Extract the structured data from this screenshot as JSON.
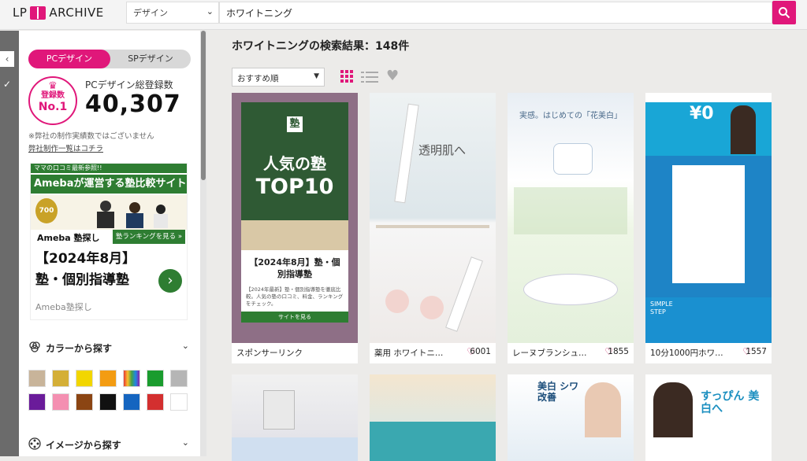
{
  "header": {
    "logo_left": "LP",
    "logo_right": "ARCHIVE",
    "category": "デザイン",
    "search_value": "ホワイトニング"
  },
  "sidebar": {
    "toggle_pc": "PCデザイン",
    "toggle_sp": "SPデザイン",
    "badge_line1": "登録数",
    "badge_line2": "No.1",
    "total_label": "PCデザイン総登録数",
    "total_value": "40,307",
    "note": "※弊社の制作実績数ではございません",
    "note_link": "弊社制作一覧はコチラ",
    "ad": {
      "banner": "ママの口コミ最新参照!!",
      "headline": "Amebaが運営する塾比較サイト",
      "badge": "700",
      "brand": "Ameba 塾探し",
      "cta": "塾ランキングを見る »",
      "title": "【2024年8月】塾・個別指導塾",
      "source": "Ameba塾探し"
    },
    "color_section": "カラーから探す",
    "image_section": "イメージから探す",
    "colors": [
      "#c8b49a",
      "#d4af37",
      "#f2d600",
      "#f39c12",
      "#e74c3c",
      "#1a9c2e",
      "#b5b5b5",
      "#6a1b9a",
      "#f48fb1",
      "#8b4513",
      "#111111",
      "#1565c0",
      "#d32f2f",
      "#ffffff"
    ]
  },
  "main": {
    "result_title": "ホワイトニングの検索結果：148件",
    "sort": "おすすめ順",
    "cards": [
      {
        "title": "スポンサーリンク",
        "likes": ""
      },
      {
        "title": "薬用 ホワイトニング…",
        "likes": "6001"
      },
      {
        "title": "レーヌブランシュ ホ…",
        "likes": "1855"
      },
      {
        "title": "10分1000円ホワイト…",
        "likes": "1557"
      }
    ],
    "sponsor": {
      "headline": "人気の塾",
      "big": "TOP10",
      "label": "塾",
      "sub": "【2024年8月】塾・個別指導塾",
      "desc": "【2024年最新】塾・個別指導塾を徹底比較。人気の塾の口コミ、料金、ランキングをチェック。",
      "button": "サイトを見る"
    },
    "card2_text": "透明肌へ",
    "card3_text": "実感。はじめての「花美白」",
    "card4_price": "¥0",
    "card4_side": "SIMPLE STEP",
    "row2_texts": [
      "",
      "",
      "美白 シワ改善",
      "すっぴん 美白へ"
    ]
  }
}
